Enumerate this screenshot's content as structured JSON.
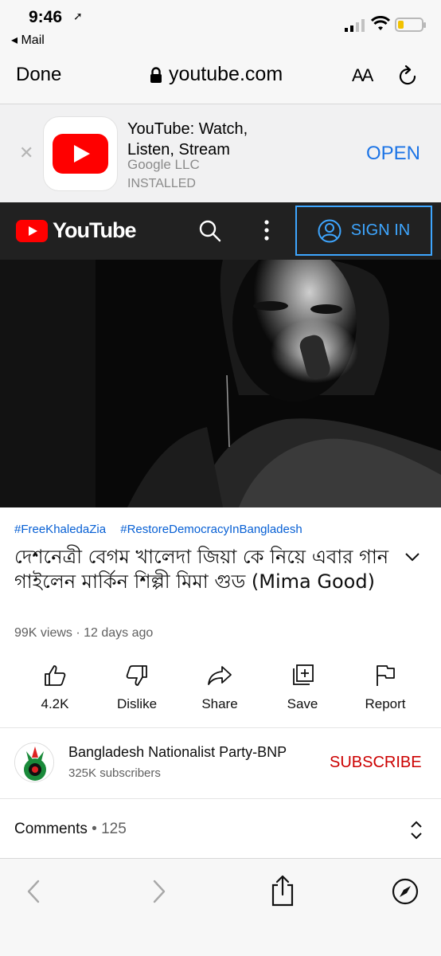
{
  "status_bar": {
    "time": "9:46",
    "back_app": "◂ Mail"
  },
  "safari": {
    "done": "Done",
    "url": "youtube.com",
    "text_size": "AA"
  },
  "app_banner": {
    "title": "YouTube: Watch, Listen, Stream",
    "developer": "Google LLC",
    "state": "INSTALLED",
    "open": "OPEN"
  },
  "youtube_header": {
    "logo": "YouTube",
    "sign_in": "SIGN IN"
  },
  "video": {
    "hashtags": [
      "#FreeKhaledaZia",
      "#RestoreDemocracyInBangladesh"
    ],
    "title": "দেশনেত্রী বেগম খালেদা জিয়া কে নিয়ে এবার গান গাইলেন মার্কিন শিল্পী মিমা গুড (Mima Good)",
    "meta": "99K views · 12 days ago"
  },
  "actions": {
    "like": "4.2K",
    "dislike": "Dislike",
    "share": "Share",
    "save": "Save",
    "report": "Report"
  },
  "channel": {
    "name": "Bangladesh Nationalist Party-BNP",
    "subscribers": "325K subscribers",
    "subscribe": "SUBSCRIBE"
  },
  "comments": {
    "label": "Comments",
    "count": " • 125"
  },
  "colors": {
    "youtube_red": "#ff0000",
    "link_blue": "#065fd4",
    "ios_blue": "#1c74e6",
    "subscribe_red": "#cc0000"
  }
}
